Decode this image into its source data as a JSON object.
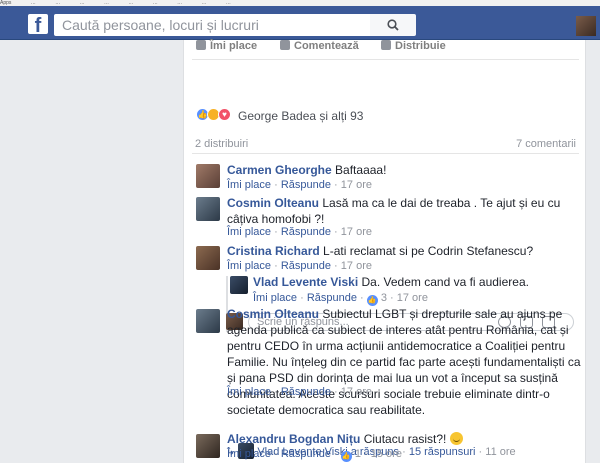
{
  "bookmarks": [
    "Apps",
    "…",
    "…",
    "…",
    "…",
    "…",
    "…",
    "…",
    "…",
    "…"
  ],
  "header": {
    "search_placeholder": "Caută persoane, locuri și lucruri"
  },
  "post_actions": {
    "like": "Îmi place",
    "comment": "Comentează",
    "share": "Distribuie"
  },
  "reactions": {
    "summary": "George Badea și alți 93",
    "icons": [
      "like-icon",
      "haha-icon",
      "love-icon"
    ]
  },
  "stats": {
    "shares": "2 distribuiri",
    "comments": "7 comentarii"
  },
  "labels": {
    "like": "Îmi place",
    "reply": "Răspunde",
    "sep": "·"
  },
  "comments": [
    {
      "name": "Carmen Gheorghe",
      "text": "Baftaaaa!",
      "time": "17 ore"
    },
    {
      "name": "Cosmin Olteanu",
      "text": "Lasă ma ca le dai de treaba . Te ajut și eu cu câțiva homofobi ?!",
      "time": "17 ore"
    },
    {
      "name": "Cristina Richard",
      "text": "L-ati reclamat si pe Codrin Stefanescu?",
      "time": "17 ore"
    },
    {
      "name": "Cosmin Olteanu",
      "text": "Subiectul LGBT și drepturile sale au ajuns pe agenda publică ca subiect de interes atât pentru România, cat și pentru CEDO în urma acțiunii antidemocratice a Coaliției pentru Familie. Nu înțeleg din ce partid fac parte acești fundamentaliști ca și pana PSD din dorința de mai lua un vot a început sa susțină comunitatea. Aceste scursuri sociale trebuie eliminate dintr-o societate democratica sau reabilitate.",
      "time": "17 ore"
    },
    {
      "name": "Alexandru Bogdan Nițu",
      "text": "Ciutacu rasist?!",
      "time": "15 ore",
      "likes": "1"
    }
  ],
  "reply": {
    "name": "Vlad Levente Viski",
    "text": "Da. Vedem cand va fi audierea.",
    "time": "17 ore",
    "likes": "3"
  },
  "reply_box": {
    "placeholder": "Scrie un răspuns..."
  },
  "more_replies": {
    "name": "Vlad Levente Viski",
    "action": "a răspuns",
    "count": "15 răspunsuri",
    "time": "11 ore"
  }
}
